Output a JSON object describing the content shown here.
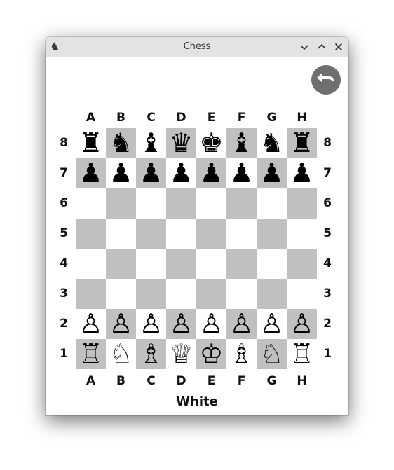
{
  "window": {
    "title": "Chess"
  },
  "board": {
    "files": [
      "A",
      "B",
      "C",
      "D",
      "E",
      "F",
      "G",
      "H"
    ],
    "ranks": [
      "8",
      "7",
      "6",
      "5",
      "4",
      "3",
      "2",
      "1"
    ],
    "rows": [
      [
        "♜",
        "♞",
        "♝",
        "♛",
        "♚",
        "♝",
        "♞",
        "♜"
      ],
      [
        "♟",
        "♟",
        "♟",
        "♟",
        "♟",
        "♟",
        "♟",
        "♟"
      ],
      [
        "",
        "",
        "",
        "",
        "",
        "",
        "",
        ""
      ],
      [
        "",
        "",
        "",
        "",
        "",
        "",
        "",
        ""
      ],
      [
        "",
        "",
        "",
        "",
        "",
        "",
        "",
        ""
      ],
      [
        "",
        "",
        "",
        "",
        "",
        "",
        "",
        ""
      ],
      [
        "♙",
        "♙",
        "♙",
        "♙",
        "♙",
        "♙",
        "♙",
        "♙"
      ],
      [
        "♖",
        "♘",
        "♗",
        "♕",
        "♔",
        "♗",
        "♘",
        "♖"
      ]
    ],
    "light_color": "#ffffff",
    "dark_color": "#c0c0c0"
  },
  "status": {
    "turn": "White"
  },
  "icons": {
    "app": "chess-knight-icon",
    "minimize": "chevron-down-icon",
    "maximize": "chevron-up-icon",
    "close": "close-icon",
    "back": "undo-arrow-icon"
  }
}
